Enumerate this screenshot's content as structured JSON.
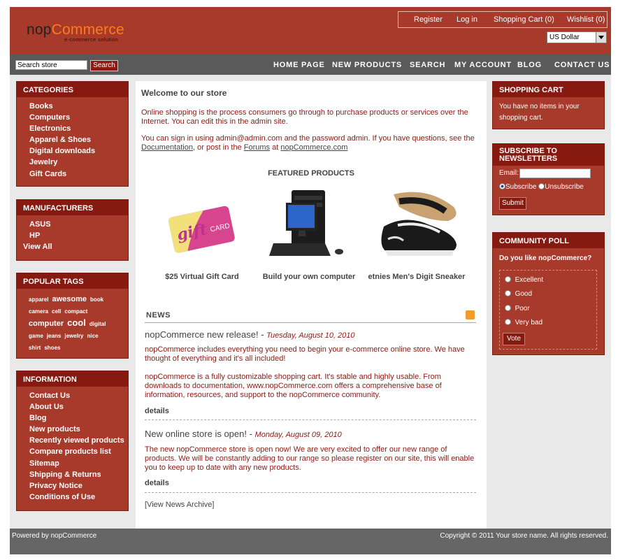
{
  "header": {
    "logo_part1": "nop",
    "logo_part2": "Commerce",
    "logo_tagline": "e-commerce solution",
    "links": {
      "register": "Register",
      "login": "Log in",
      "cart": "Shopping Cart (0)",
      "wishlist": "Wishlist (0)"
    },
    "currency": "US Dollar"
  },
  "nav": {
    "search_placeholder": "Search store",
    "search_button": "Search",
    "menu": [
      "HOME PAGE",
      "NEW PRODUCTS",
      "SEARCH",
      "MY ACCOUNT",
      "BLOG",
      "CONTACT US"
    ]
  },
  "categories": {
    "title": "CATEGORIES",
    "items": [
      "Books",
      "Computers",
      "Electronics",
      "Apparel & Shoes",
      "Digital downloads",
      "Jewelry",
      "Gift Cards"
    ]
  },
  "manufacturers": {
    "title": "MANUFACTURERS",
    "items": [
      "ASUS",
      "HP"
    ],
    "view_all": "View All"
  },
  "popular_tags": {
    "title": "POPULAR TAGS",
    "tags": [
      "apparel",
      "awesome",
      "book",
      "camera",
      "cell",
      "compact",
      "computer",
      "cool",
      "digital",
      "game",
      "jeans",
      "jewelry",
      "nice",
      "shirt",
      "shoes"
    ]
  },
  "information": {
    "title": "INFORMATION",
    "items": [
      "Contact Us",
      "About Us",
      "Blog",
      "New products",
      "Recently viewed products",
      "Compare products list",
      "Sitemap",
      "Shipping & Returns",
      "Privacy Notice",
      "Conditions of Use"
    ]
  },
  "main": {
    "welcome": "Welcome to our store",
    "intro": "Online shopping is the process consumers go through to purchase products or services over the Internet. You can edit this in the admin site.",
    "signin_pre": "You can sign in using admin@admin.com and the password admin. If you have questions, see the",
    "doc_link": "Documentation",
    "signin_mid": ", or post in the",
    "forums_link": "Forums",
    "signin_at": "at",
    "site_link": "nopCommerce.com",
    "featured_title": "FEATURED PRODUCTS",
    "products": [
      "$25 Virtual Gift Card",
      "Build your own computer",
      "etnies Men's Digit Sneaker"
    ],
    "gift_text": "gift",
    "gift_card": "CARD"
  },
  "news": {
    "title": "NEWS",
    "items": [
      {
        "title": "nopCommerce new release!",
        "date": "Tuesday, August 10, 2010",
        "p1": "nopCommerce includes everything you need to begin your e-commerce online store. We have thought of everything and it's all included!",
        "p2": "nopCommerce is a fully customizable shopping cart. It's stable and highly usable. From downloads to documentation, www.nopCommerce.com offers a comprehensive base of information, resources, and support to the nopCommerce community.",
        "details": "details"
      },
      {
        "title": "New online store is open!",
        "date": "Monday, August 09, 2010",
        "p1": "The new nopCommerce store is open now! We are very excited to offer our new range of products. We will be constantly adding to our range so please register on our site, this will enable you to keep up to date with any new products.",
        "details": "details"
      }
    ],
    "archive": "[View News Archive]"
  },
  "shopping_cart": {
    "title": "SHOPPING CART",
    "text": "You have no items in your shopping cart."
  },
  "newsletter": {
    "title_line1": "SUBSCRIBE TO",
    "title_line2": "NEWSLETTERS",
    "email_label": "Email:",
    "subscribe": "Subscribe",
    "unsubscribe": "Unsubscribe",
    "submit": "Submit"
  },
  "poll": {
    "title": "COMMUNITY POLL",
    "question": "Do you like nopCommerce?",
    "options": [
      "Excellent",
      "Good",
      "Poor",
      "Very bad"
    ],
    "vote": "Vote"
  },
  "footer": {
    "left": "Powered by nopCommerce",
    "right": "Copyright © 2011 Your store name. All rights reserved."
  },
  "colors": {
    "brand": "#a83a2c",
    "brand_dark": "#861a10",
    "nav": "#5a5a5a",
    "logo_accent": "#ff7a1a"
  }
}
